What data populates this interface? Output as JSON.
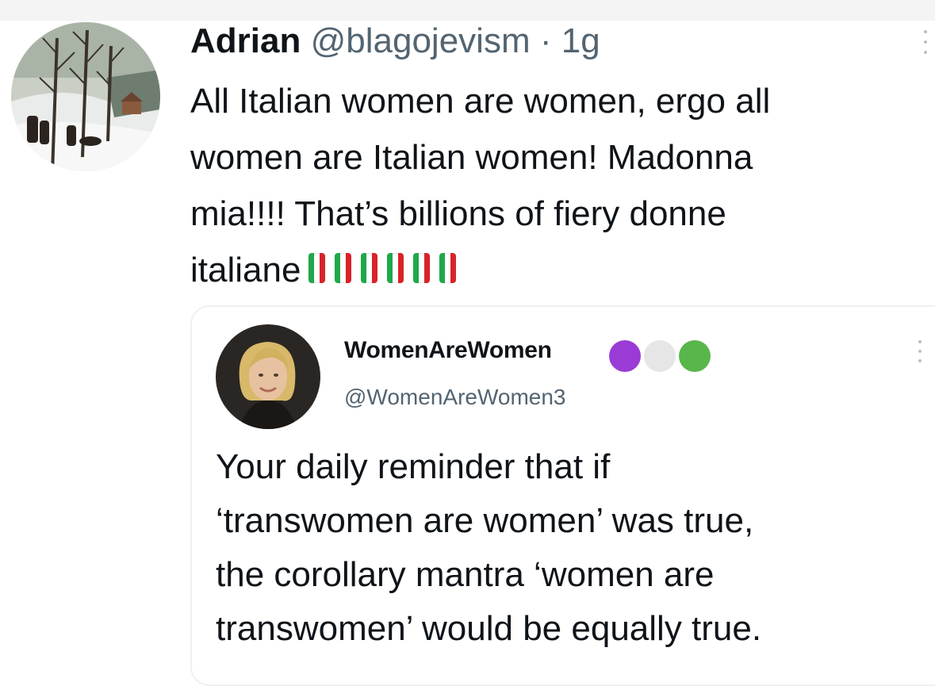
{
  "tweet": {
    "name": "Adrian",
    "handle": "@blagojevism",
    "separator": "·",
    "time": "1g",
    "text_lines": [
      "All Italian women are women, ergo all",
      "women are Italian women! Madonna",
      "mia!!!! That’s billions of fiery donne",
      "italiane"
    ],
    "flag_emoji_count": 6,
    "flag_colors": [
      "#1fa84a",
      "#ffffff",
      "#d8232a"
    ],
    "avatar_icon": "winter-landscape-painting-avatar"
  },
  "quote": {
    "name": "WomenAreWomen",
    "handle": "@WomenAreWomen3",
    "badge_colors": [
      "#9b3bd6",
      "#e6e6e6",
      "#58b64a"
    ],
    "avatar_icon": "person-portrait-avatar",
    "text_lines": [
      "Your daily reminder that if",
      "‘transwomen are women’ was true,",
      "the corollary mantra ‘women are",
      "transwomen’ would be equally true."
    ]
  }
}
